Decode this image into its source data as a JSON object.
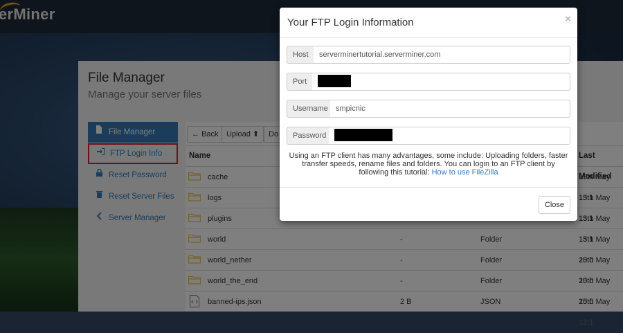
{
  "brand": {
    "name": "erMiner"
  },
  "page": {
    "title": "File Manager",
    "subtitle": "Manage your server files"
  },
  "sidebar": {
    "items": [
      {
        "label": "File Manager",
        "icon": "file-icon",
        "active": true
      },
      {
        "label": "FTP Login Info",
        "icon": "login-icon",
        "highlighted": true
      },
      {
        "label": "Reset Password",
        "icon": "lock-icon"
      },
      {
        "label": "Reset Server Files",
        "icon": "trash-icon"
      },
      {
        "label": "Server Manager",
        "icon": "chevron-left-icon"
      }
    ]
  },
  "toolbar": {
    "back_label": "Back",
    "upload_label": "Upload",
    "partial_label": "Do"
  },
  "table": {
    "columns": {
      "name": "Name",
      "last_modified": "Last Modified"
    },
    "rows": [
      {
        "name": "cache",
        "size": "",
        "type": "",
        "modified": "15th May 13:1",
        "kind": "folder"
      },
      {
        "name": "logs",
        "size": "",
        "type": "",
        "modified": "15th May 13:1",
        "kind": "folder"
      },
      {
        "name": "plugins",
        "size": "",
        "type": "",
        "modified": "15th May 13:1",
        "kind": "folder"
      },
      {
        "name": "world",
        "size": "-",
        "type": "Folder",
        "modified": "15th May 20:0",
        "kind": "folder"
      },
      {
        "name": "world_nether",
        "size": "-",
        "type": "Folder",
        "modified": "15th May 20:0",
        "kind": "folder"
      },
      {
        "name": "world_the_end",
        "size": "-",
        "type": "Folder",
        "modified": "15th May 20:0",
        "kind": "folder"
      },
      {
        "name": "banned-ips.json",
        "size": "2 B",
        "type": "JSON",
        "modified": "15th May 13:1",
        "kind": "file"
      }
    ]
  },
  "modal": {
    "title": "Your FTP Login Information",
    "close_x": "×",
    "fields": {
      "host": {
        "label": "Host",
        "value": "serverminertutorial.serverminer.com"
      },
      "port": {
        "label": "Port",
        "value": ""
      },
      "username": {
        "label": "Username",
        "value": "smpicnic"
      },
      "password": {
        "label": "Password",
        "value": ""
      }
    },
    "body_text": "Using an FTP client has many advantages, some include: Uploading folders, faster transfer speeds, rename files and folders. You can login to an FTP client by following this tutorial: ",
    "link_text": "How to use FileZilla",
    "close_button": "Close"
  },
  "colors": {
    "primary": "#337ab7",
    "highlight_outline": "#e02020",
    "folder": "#e8c15a",
    "accent_logo": "#f0a21a"
  }
}
